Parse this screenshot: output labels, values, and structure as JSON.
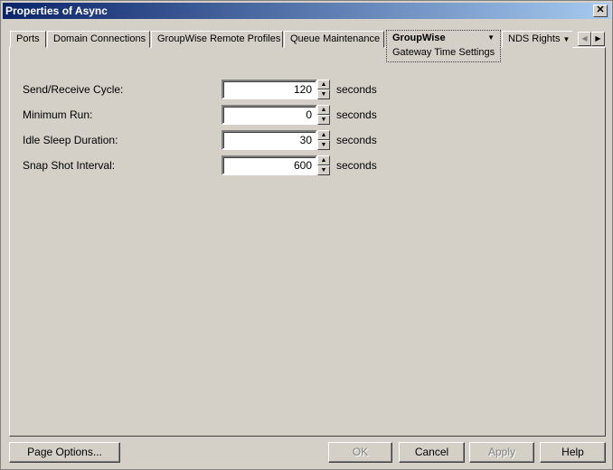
{
  "window": {
    "title": "Properties of Async",
    "close": "✕"
  },
  "tabs": [
    {
      "label": "Ports"
    },
    {
      "label": "Domain Connections"
    },
    {
      "label": "GroupWise Remote Profiles"
    },
    {
      "label": "Queue Maintenance"
    },
    {
      "label": "GroupWise",
      "subtab": "Gateway Time Settings"
    },
    {
      "label": "NDS Rights"
    }
  ],
  "fields": [
    {
      "label": "Send/Receive Cycle:",
      "value": "120",
      "unit": "seconds"
    },
    {
      "label": "Minimum Run:",
      "value": "0",
      "unit": "seconds"
    },
    {
      "label": "Idle Sleep Duration:",
      "value": "30",
      "unit": "seconds"
    },
    {
      "label": "Snap Shot Interval:",
      "value": "600",
      "unit": "seconds"
    }
  ],
  "buttons": {
    "page_options": "Page Options...",
    "ok": "OK",
    "cancel": "Cancel",
    "apply": "Apply",
    "help": "Help"
  }
}
